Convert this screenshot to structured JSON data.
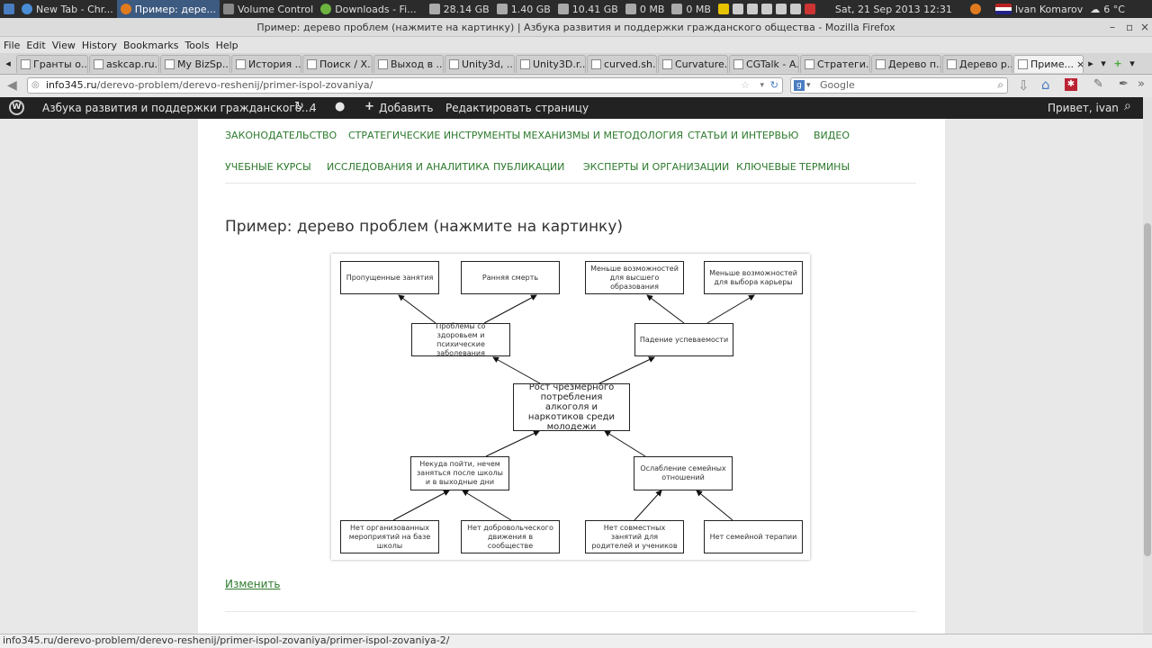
{
  "taskbar": {
    "items": [
      "New Tab - Chr...",
      "Пример: дере...",
      "Volume Control",
      "Downloads - Fi..."
    ],
    "disk1": "28.14 GB",
    "mem": "1.40 GB",
    "disk2": "10.41 GB",
    "net1": "0 MB",
    "net2": "0 MB",
    "datetime": "Sat, 21 Sep 2013 12:31",
    "user": "Ivan Komarov",
    "weather": "6 °C"
  },
  "window": {
    "title": "Пример: дерево проблем (нажмите на картинку) | Азбука развития и поддержки гражданского общества - Mozilla Firefox"
  },
  "menu": [
    "File",
    "Edit",
    "View",
    "History",
    "Bookmarks",
    "Tools",
    "Help"
  ],
  "tabs": [
    "Гранты о...",
    "askcap.ru...",
    "My BizSp...",
    "История ...",
    "Поиск / Х...",
    "Выход в ...",
    "Unity3d, ...",
    "Unity3D.r...",
    "curved.sh...",
    "Curvature...",
    "CGTalk - A...",
    "Стратеги...",
    "Дерево п...",
    "Дерево р...",
    "Приме..."
  ],
  "url": {
    "host": "info345.ru",
    "path": "/derevo-problem/derevo-reshenij/primer-ispol-zovaniya/"
  },
  "search": {
    "placeholder": "Google"
  },
  "wpbar": {
    "site": "Азбука развития и поддержки гражданского...",
    "updates": "4",
    "add": "Добавить",
    "edit": "Редактировать страницу",
    "greeting": "Привет, ivan"
  },
  "nav": {
    "row1": [
      "ЗАКОНОДАТЕЛЬСТВО",
      "СТРАТЕГИЧЕСКИЕ ИНСТРУМЕНТЫ",
      "МЕХАНИЗМЫ И МЕТОДОЛОГИЯ",
      "СТАТЬИ И ИНТЕРВЬЮ",
      "ВИДЕО"
    ],
    "row2": [
      "УЧЕБНЫЕ КУРСЫ",
      "ИССЛЕДОВАНИЯ И АНАЛИТИКА",
      "ПУБЛИКАЦИИ",
      "ЭКСПЕРТЫ И ОРГАНИЗАЦИИ",
      "КЛЮЧЕВЫЕ ТЕРМИНЫ"
    ]
  },
  "page": {
    "title": "Пример: дерево проблем (нажмите на картинку)",
    "edit_link": "Изменить"
  },
  "diagram": {
    "effects_top": [
      "Пропущенные занятия",
      "Ранняя смерть",
      "Меньше возможностей для высшего образования",
      "Меньше возможностей для выбора карьеры"
    ],
    "effects_mid": [
      "Проблемы со здоровьем и психические заболевания",
      "Падение успеваемости"
    ],
    "core": "Рост чрезмерного потребления алкоголя и наркотиков среди молодежи",
    "causes_mid": [
      "Некуда пойти, нечем заняться после школы и в выходные дни",
      "Ослабление семейных отношений"
    ],
    "causes_bottom": [
      "Нет организованных мероприятий на базе школы",
      "Нет добровольческого движения в сообществе",
      "Нет совместных занятий для родителей и учеников",
      "Нет семейной терапии"
    ]
  },
  "status": "info345.ru/derevo-problem/derevo-reshenij/primer-ispol-zovaniya/primer-ispol-zovaniya-2/"
}
